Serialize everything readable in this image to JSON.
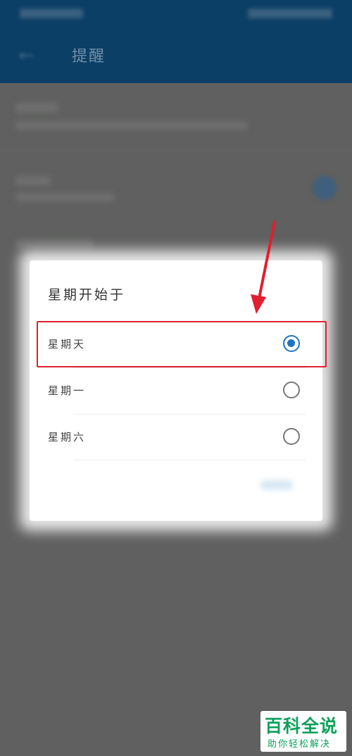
{
  "app": {
    "title": "提醒"
  },
  "dialog": {
    "title": "星期开始于",
    "options": [
      {
        "label": "星期天",
        "selected": true
      },
      {
        "label": "星期一",
        "selected": false
      },
      {
        "label": "星期六",
        "selected": false
      }
    ]
  },
  "annotation": {
    "highlight_color": "#e02030",
    "arrow_color": "#e02030"
  },
  "watermark": {
    "main": "百科全说",
    "sub": "助你轻松解决"
  },
  "colors": {
    "accent": "#1e74c4",
    "appbar": "#0c3f66",
    "watermark": "#0ea15b"
  }
}
